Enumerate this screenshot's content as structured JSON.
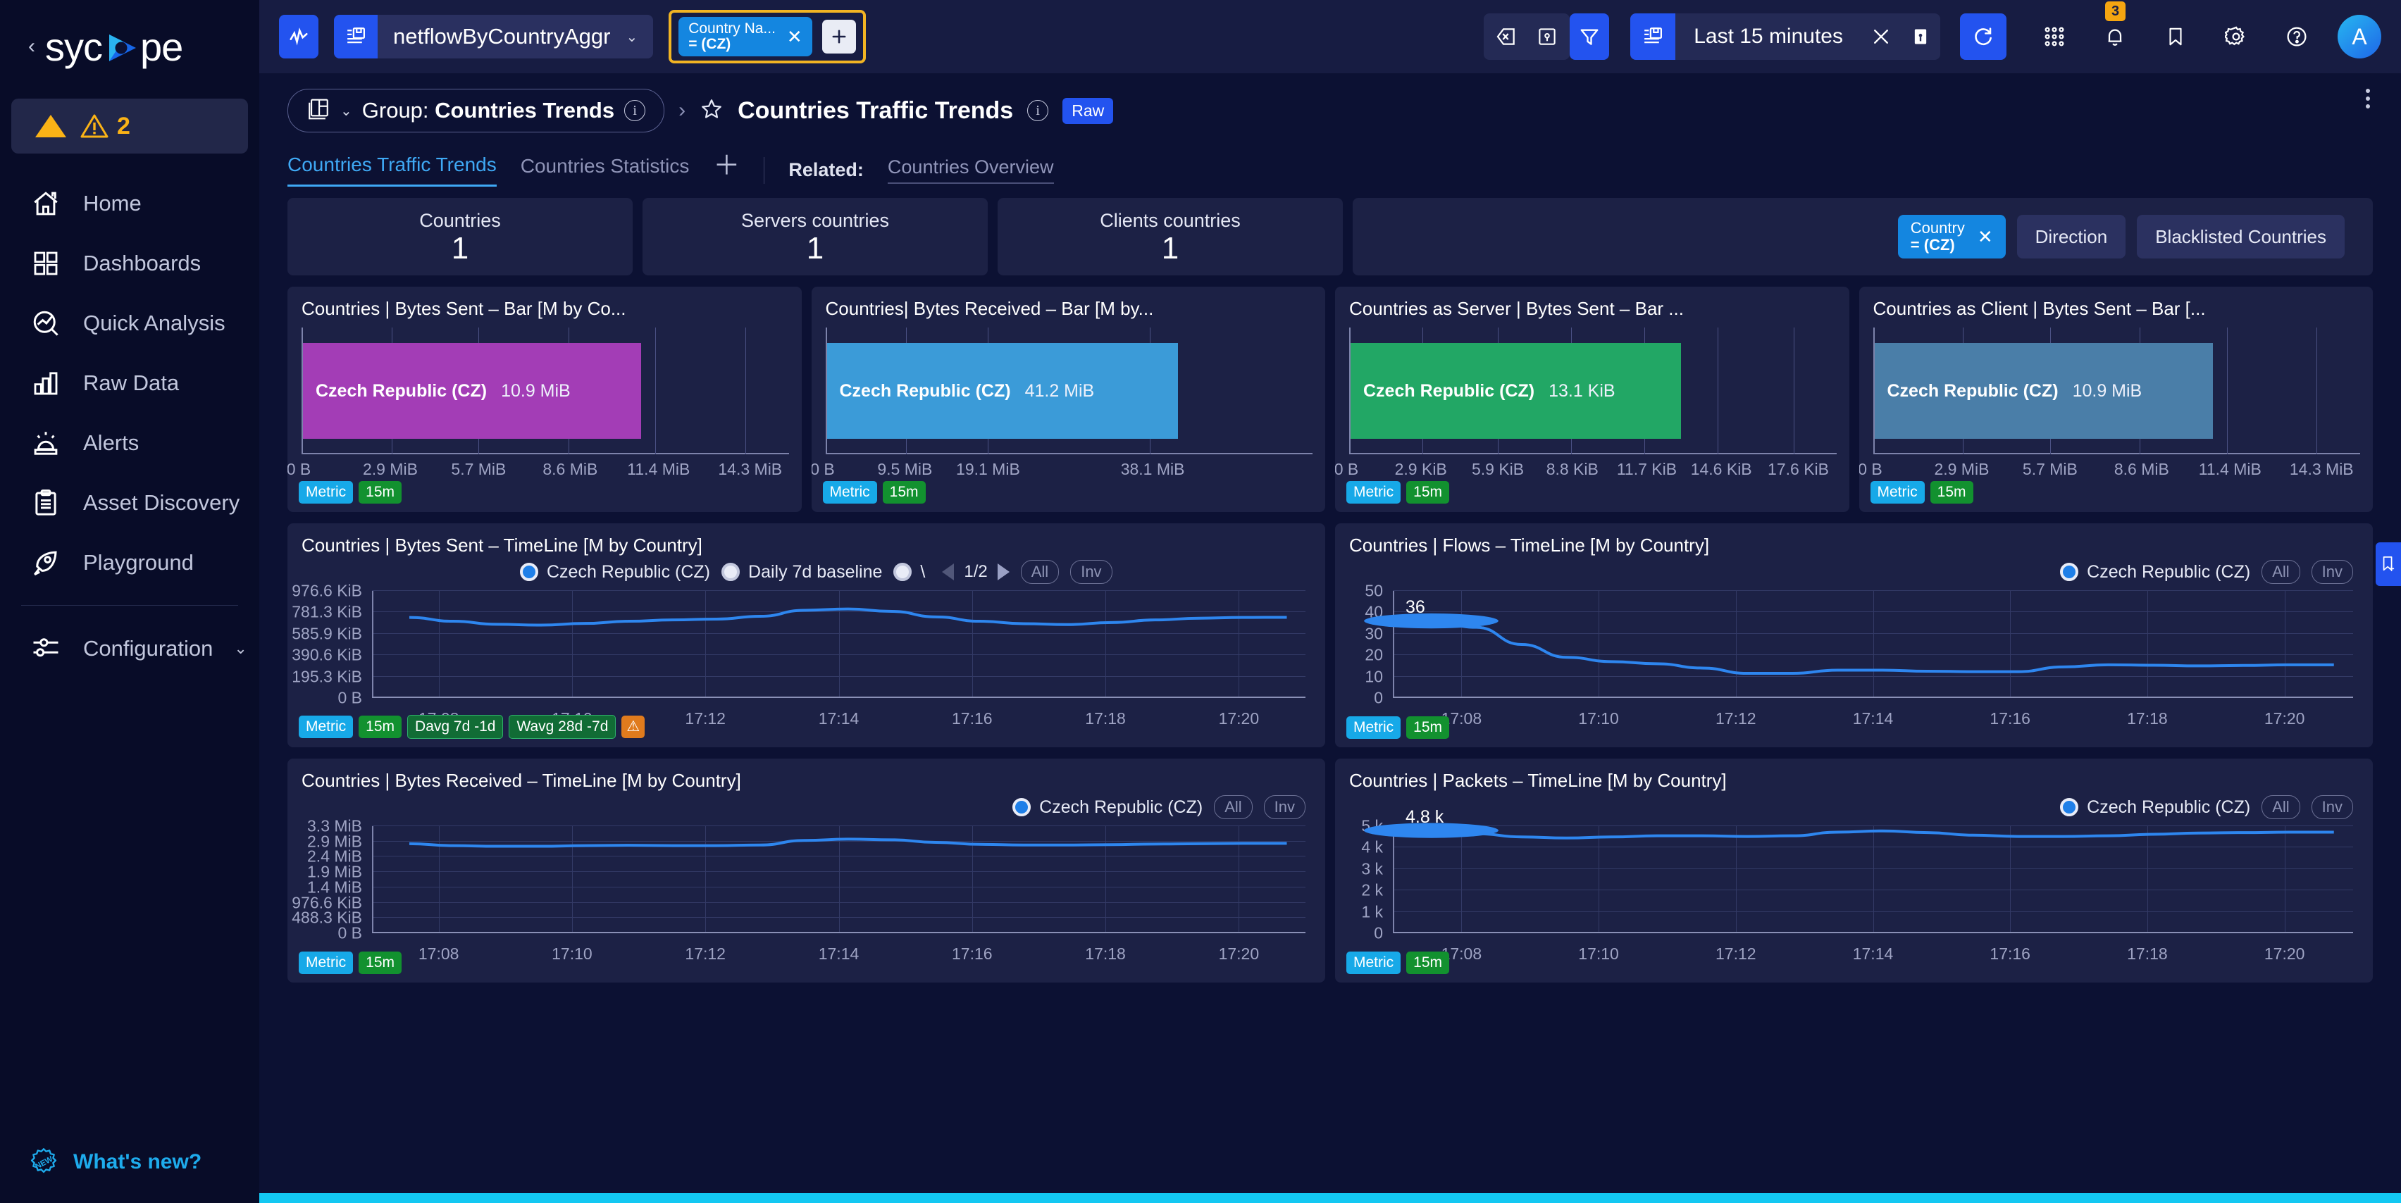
{
  "brand": {
    "name": "sycope",
    "collapse_icon": "chevron-left-icon"
  },
  "sidebar": {
    "alarm": {
      "count": "2",
      "triangle_icon": "alarm-triangle-icon",
      "warning_icon": "warning-triangle-icon"
    },
    "items": [
      {
        "label": "Home",
        "icon": "home-icon"
      },
      {
        "label": "Dashboards",
        "icon": "grid-squares-icon"
      },
      {
        "label": "Quick Analysis",
        "icon": "magnifier-chart-icon"
      },
      {
        "label": "Raw Data",
        "icon": "bar-chart-icon"
      },
      {
        "label": "Alerts",
        "icon": "siren-icon"
      },
      {
        "label": "Asset Discovery",
        "icon": "clipboard-list-icon"
      },
      {
        "label": "Playground",
        "icon": "rocket-icon"
      }
    ],
    "config": {
      "label": "Configuration",
      "icon": "sliders-icon",
      "chevron": "chevron-down-icon"
    },
    "whats_new": {
      "label": "What's new?",
      "icon": "new-badge-icon"
    }
  },
  "topbar": {
    "pulse_icon": "pulse-activity-icon",
    "datasource": {
      "icon": "dataset-save-icon",
      "label": "netflowByCountryAggr",
      "chevron": "chevron-down-icon"
    },
    "filter_chip": {
      "line1": "Country Na...",
      "line2": "= (CZ)",
      "close_icon": "close-icon"
    },
    "add_filter": {
      "label": "+",
      "icon": "plus-icon"
    },
    "clear_icon": "clear-query-icon",
    "save_query_icon": "save-query-icon",
    "filter_icon": "funnel-filter-icon",
    "time": {
      "icon": "time-preset-icon",
      "label": "Last 15 minutes",
      "clear_icon": "close-icon",
      "save_icon": "save-icon"
    },
    "refresh_icon": "refresh-icon",
    "apps_icon": "apps-grid-icon",
    "notifications": {
      "icon": "bell-icon",
      "badge": "3"
    },
    "bookmark_icon": "bookmark-icon",
    "settings_icon": "gear-icon",
    "help_icon": "help-circle-icon",
    "avatar": {
      "initial": "A"
    }
  },
  "header": {
    "group_icon": "dashboard-group-icon",
    "group_chevron": "chevron-down-icon",
    "group_prefix": "Group:",
    "group_name": "Countries Trends",
    "group_info_icon": "info-icon",
    "separator": "›",
    "star_icon": "star-outline-icon",
    "title": "Countries Traffic Trends",
    "title_info_icon": "info-icon",
    "raw_badge": "Raw",
    "kebab_icon": "more-vertical-icon",
    "tabs": [
      {
        "label": "Countries Traffic Trends",
        "active": true
      },
      {
        "label": "Countries Statistics",
        "active": false
      }
    ],
    "add_tab_icon": "plus-icon",
    "related_label": "Related:",
    "related_links": [
      "Countries Overview"
    ]
  },
  "stats": [
    {
      "label": "Countries",
      "value": "1"
    },
    {
      "label": "Servers countries",
      "value": "1"
    },
    {
      "label": "Clients countries",
      "value": "1"
    }
  ],
  "filter_chips": {
    "active": {
      "line1": "Country",
      "line2": "= (CZ)",
      "close_icon": "close-icon"
    },
    "others": [
      "Direction",
      "Blacklisted Countries"
    ]
  },
  "chart_data": [
    {
      "type": "bar",
      "title": "Countries | Bytes Sent – Bar [M by Co...",
      "categories": [
        "Czech Republic (CZ)"
      ],
      "values": [
        10.9
      ],
      "value_labels": [
        "10.9 MiB"
      ],
      "bar_color": "#a33db6",
      "xlabel": "",
      "ylabel": "",
      "xticks": [
        "0 B",
        "2.9 MiB",
        "5.7 MiB",
        "8.6 MiB",
        "11.4 MiB",
        "14.3 MiB"
      ],
      "xlim": [
        0,
        15.7
      ],
      "tags": [
        {
          "text": "Metric",
          "kind": "metric"
        },
        {
          "text": "15m",
          "kind": "time"
        }
      ]
    },
    {
      "type": "bar",
      "title": "Countries| Bytes Received – Bar [M by...",
      "categories": [
        "Czech Republic (CZ)"
      ],
      "values": [
        41.2
      ],
      "value_labels": [
        "41.2 MiB"
      ],
      "bar_color": "#3b9bd8",
      "xlabel": "",
      "ylabel": "",
      "xticks": [
        "0 B",
        "9.5 MiB",
        "19.1 MiB",
        "38.1 MiB"
      ],
      "xlim": [
        0,
        57.2
      ],
      "tags": [
        {
          "text": "Metric",
          "kind": "metric"
        },
        {
          "text": "15m",
          "kind": "time"
        }
      ]
    },
    {
      "type": "bar",
      "title": "Countries as Server | Bytes Sent – Bar ...",
      "categories": [
        "Czech Republic (CZ)"
      ],
      "values": [
        13.1
      ],
      "value_labels": [
        "13.1 KiB"
      ],
      "bar_color": "#22a765",
      "xlabel": "",
      "ylabel": "",
      "xticks": [
        "0 B",
        "2.9 KiB",
        "5.9 KiB",
        "8.8 KiB",
        "11.7 KiB",
        "14.6 KiB",
        "17.6 KiB"
      ],
      "xlim": [
        0,
        19.3
      ],
      "tags": [
        {
          "text": "Metric",
          "kind": "metric"
        },
        {
          "text": "15m",
          "kind": "time"
        }
      ]
    },
    {
      "type": "bar",
      "title": "Countries as Client | Bytes Sent – Bar [...",
      "categories": [
        "Czech Republic (CZ)"
      ],
      "values": [
        10.9
      ],
      "value_labels": [
        "10.9 MiB"
      ],
      "bar_color": "#4a7ea8",
      "xlabel": "",
      "ylabel": "",
      "xticks": [
        "0 B",
        "2.9 MiB",
        "5.7 MiB",
        "8.6 MiB",
        "11.4 MiB",
        "14.3 MiB"
      ],
      "xlim": [
        0,
        15.7
      ],
      "tags": [
        {
          "text": "Metric",
          "kind": "metric"
        },
        {
          "text": "15m",
          "kind": "time"
        }
      ]
    },
    {
      "type": "line",
      "title": "Countries | Bytes Sent – TimeLine [M by Country]",
      "ylabel": "bytes",
      "yticks": [
        "0 B",
        "195.3 KiB",
        "390.6 KiB",
        "585.9 KiB",
        "781.3 KiB",
        "976.6 KiB"
      ],
      "ylim": [
        0,
        976.6
      ],
      "xticks": [
        "17:08",
        "17:10",
        "17:12",
        "17:14",
        "17:16",
        "17:18",
        "17:20"
      ],
      "series": [
        {
          "name": "Czech Republic (CZ)",
          "color": "#2e86ef",
          "values": [
            735,
            700,
            672,
            665,
            680,
            700,
            712,
            720,
            745,
            800,
            812,
            790,
            740,
            700,
            678,
            670,
            688,
            712,
            728,
            735,
            736
          ]
        }
      ],
      "legend": [
        {
          "label": "Czech Republic (CZ)",
          "enabled": true
        },
        {
          "label": "Daily 7d baseline",
          "enabled": false
        },
        {
          "label": "\\",
          "enabled": false
        }
      ],
      "pager": {
        "page": "1/2",
        "prev_icon": "triangle-left-icon",
        "next_icon": "triangle-right-icon"
      },
      "buttons": [
        "All",
        "Inv"
      ],
      "tags": [
        {
          "text": "Metric",
          "kind": "metric"
        },
        {
          "text": "15m",
          "kind": "time"
        },
        {
          "text": "Davg 7d -1d",
          "kind": "avg"
        },
        {
          "text": "Wavg 28d -7d",
          "kind": "avg"
        },
        {
          "text": "⚠",
          "kind": "warn"
        }
      ]
    },
    {
      "type": "line",
      "title": "Countries | Flows – TimeLine [M by Country]",
      "ylabel": "flows",
      "yticks": [
        "0",
        "10",
        "20",
        "30",
        "40",
        "50"
      ],
      "ylim": [
        0,
        50
      ],
      "xticks": [
        "17:08",
        "17:10",
        "17:12",
        "17:14",
        "17:16",
        "17:18",
        "17:20"
      ],
      "peak_label": "36",
      "series": [
        {
          "name": "Czech Republic (CZ)",
          "color": "#2e86ef",
          "values": [
            36,
            33,
            25,
            19,
            17,
            16,
            14,
            11.5,
            11.5,
            13,
            13,
            12.5,
            12.3,
            12.3,
            14.5,
            15.5,
            15.3,
            15,
            15.2,
            15.5,
            15.5
          ]
        }
      ],
      "legend": [
        {
          "label": "Czech Republic (CZ)",
          "enabled": true
        }
      ],
      "buttons": [
        "All",
        "Inv"
      ],
      "tags": [
        {
          "text": "Metric",
          "kind": "metric"
        },
        {
          "text": "15m",
          "kind": "time"
        }
      ]
    },
    {
      "type": "line",
      "title": "Countries | Bytes Received – TimeLine [M by Country]",
      "ylabel": "bytes",
      "yticks": [
        "0 B",
        "488.3 KiB",
        "976.6 KiB",
        "1.4 MiB",
        "1.9 MiB",
        "2.4 MiB",
        "2.9 MiB",
        "3.3 MiB"
      ],
      "ylim": [
        0,
        3.3
      ],
      "xticks": [
        "17:08",
        "17:10",
        "17:12",
        "17:14",
        "17:16",
        "17:18",
        "17:20"
      ],
      "series": [
        {
          "name": "Czech Republic (CZ)",
          "color": "#2e86ef",
          "values": [
            2.76,
            2.7,
            2.68,
            2.68,
            2.7,
            2.71,
            2.7,
            2.7,
            2.72,
            2.86,
            2.9,
            2.88,
            2.8,
            2.74,
            2.72,
            2.72,
            2.73,
            2.75,
            2.76,
            2.77,
            2.77
          ]
        }
      ],
      "legend": [
        {
          "label": "Czech Republic (CZ)",
          "enabled": true
        }
      ],
      "buttons": [
        "All",
        "Inv"
      ],
      "tags": [
        {
          "text": "Metric",
          "kind": "metric"
        },
        {
          "text": "15m",
          "kind": "time"
        }
      ]
    },
    {
      "type": "line",
      "title": "Countries | Packets – TimeLine [M by Country]",
      "ylabel": "packets",
      "yticks": [
        "0",
        "1 k",
        "2 k",
        "3 k",
        "4 k",
        "5 k"
      ],
      "ylim": [
        0,
        5
      ],
      "xticks": [
        "17:08",
        "17:10",
        "17:12",
        "17:14",
        "17:16",
        "17:18",
        "17:20"
      ],
      "peak_label": "4.8 k",
      "series": [
        {
          "name": "Czech Republic (CZ)",
          "color": "#2e86ef",
          "values": [
            4.8,
            4.65,
            4.5,
            4.45,
            4.5,
            4.55,
            4.55,
            4.52,
            4.55,
            4.72,
            4.78,
            4.7,
            4.58,
            4.52,
            4.52,
            4.55,
            4.62,
            4.68,
            4.7,
            4.72,
            4.72
          ]
        }
      ],
      "legend": [
        {
          "label": "Czech Republic (CZ)",
          "enabled": true
        }
      ],
      "buttons": [
        "All",
        "Inv"
      ],
      "tags": [
        {
          "text": "Metric",
          "kind": "metric"
        },
        {
          "text": "15m",
          "kind": "time"
        }
      ]
    }
  ],
  "right_tab": {
    "icon": "bookmark-add-icon"
  }
}
